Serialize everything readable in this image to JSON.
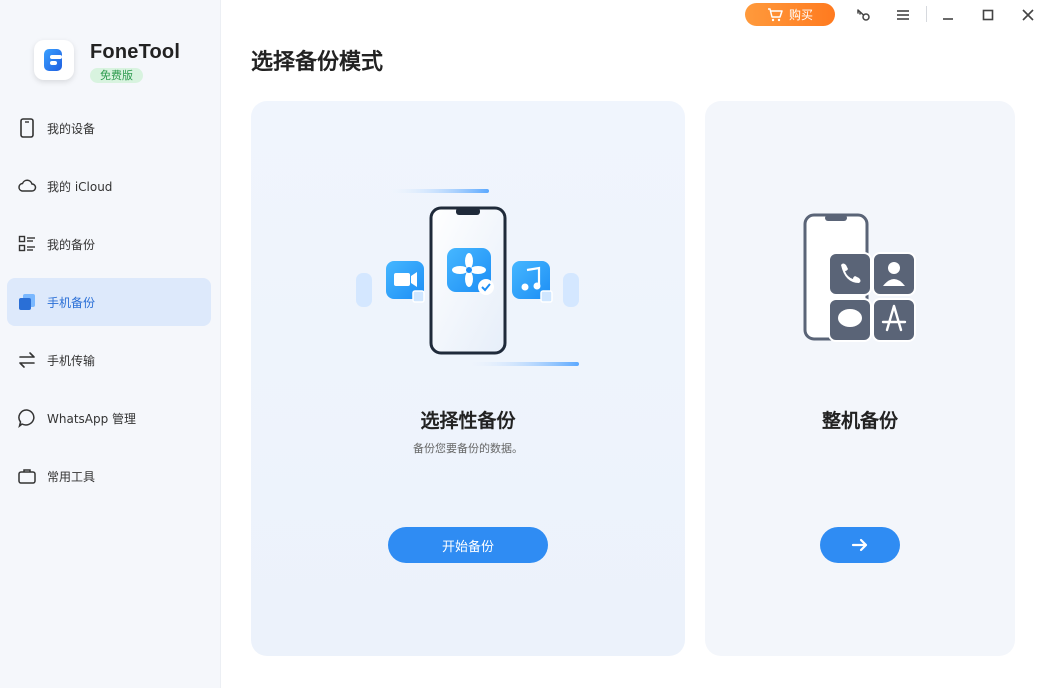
{
  "app": {
    "name": "FoneTool",
    "edition_badge": "免费版"
  },
  "titlebar": {
    "buy_label": "购买",
    "icons": [
      "cart-icon",
      "key-icon",
      "menu-icon",
      "minimize-icon",
      "maximize-icon",
      "close-icon"
    ]
  },
  "sidebar": {
    "items": [
      {
        "label": "我的设备",
        "icon": "phone-icon",
        "active": false
      },
      {
        "label": "我的 iCloud",
        "icon": "cloud-icon",
        "active": false
      },
      {
        "label": "我的备份",
        "icon": "backup-list-icon",
        "active": false
      },
      {
        "label": "手机备份",
        "icon": "phone-backup-icon",
        "active": true
      },
      {
        "label": "手机传输",
        "icon": "transfer-icon",
        "active": false
      },
      {
        "label": "WhatsApp 管理",
        "icon": "chat-bubble-icon",
        "active": false
      },
      {
        "label": "常用工具",
        "icon": "toolbox-icon",
        "active": false
      }
    ]
  },
  "main": {
    "title": "选择备份模式",
    "cards": [
      {
        "title": "选择性备份",
        "description": "备份您要备份的数据。",
        "button_label": "开始备份"
      },
      {
        "title": "整机备份",
        "description": "",
        "button_icon": "arrow-right-icon"
      }
    ]
  },
  "colors": {
    "accent": "#2f8cf3",
    "buy_button": "#ff8a2a",
    "active_nav_bg": "#dde9fb",
    "active_nav_text": "#2a6fd6",
    "badge_bg": "#d8f3df",
    "badge_text": "#2e9b4f"
  }
}
